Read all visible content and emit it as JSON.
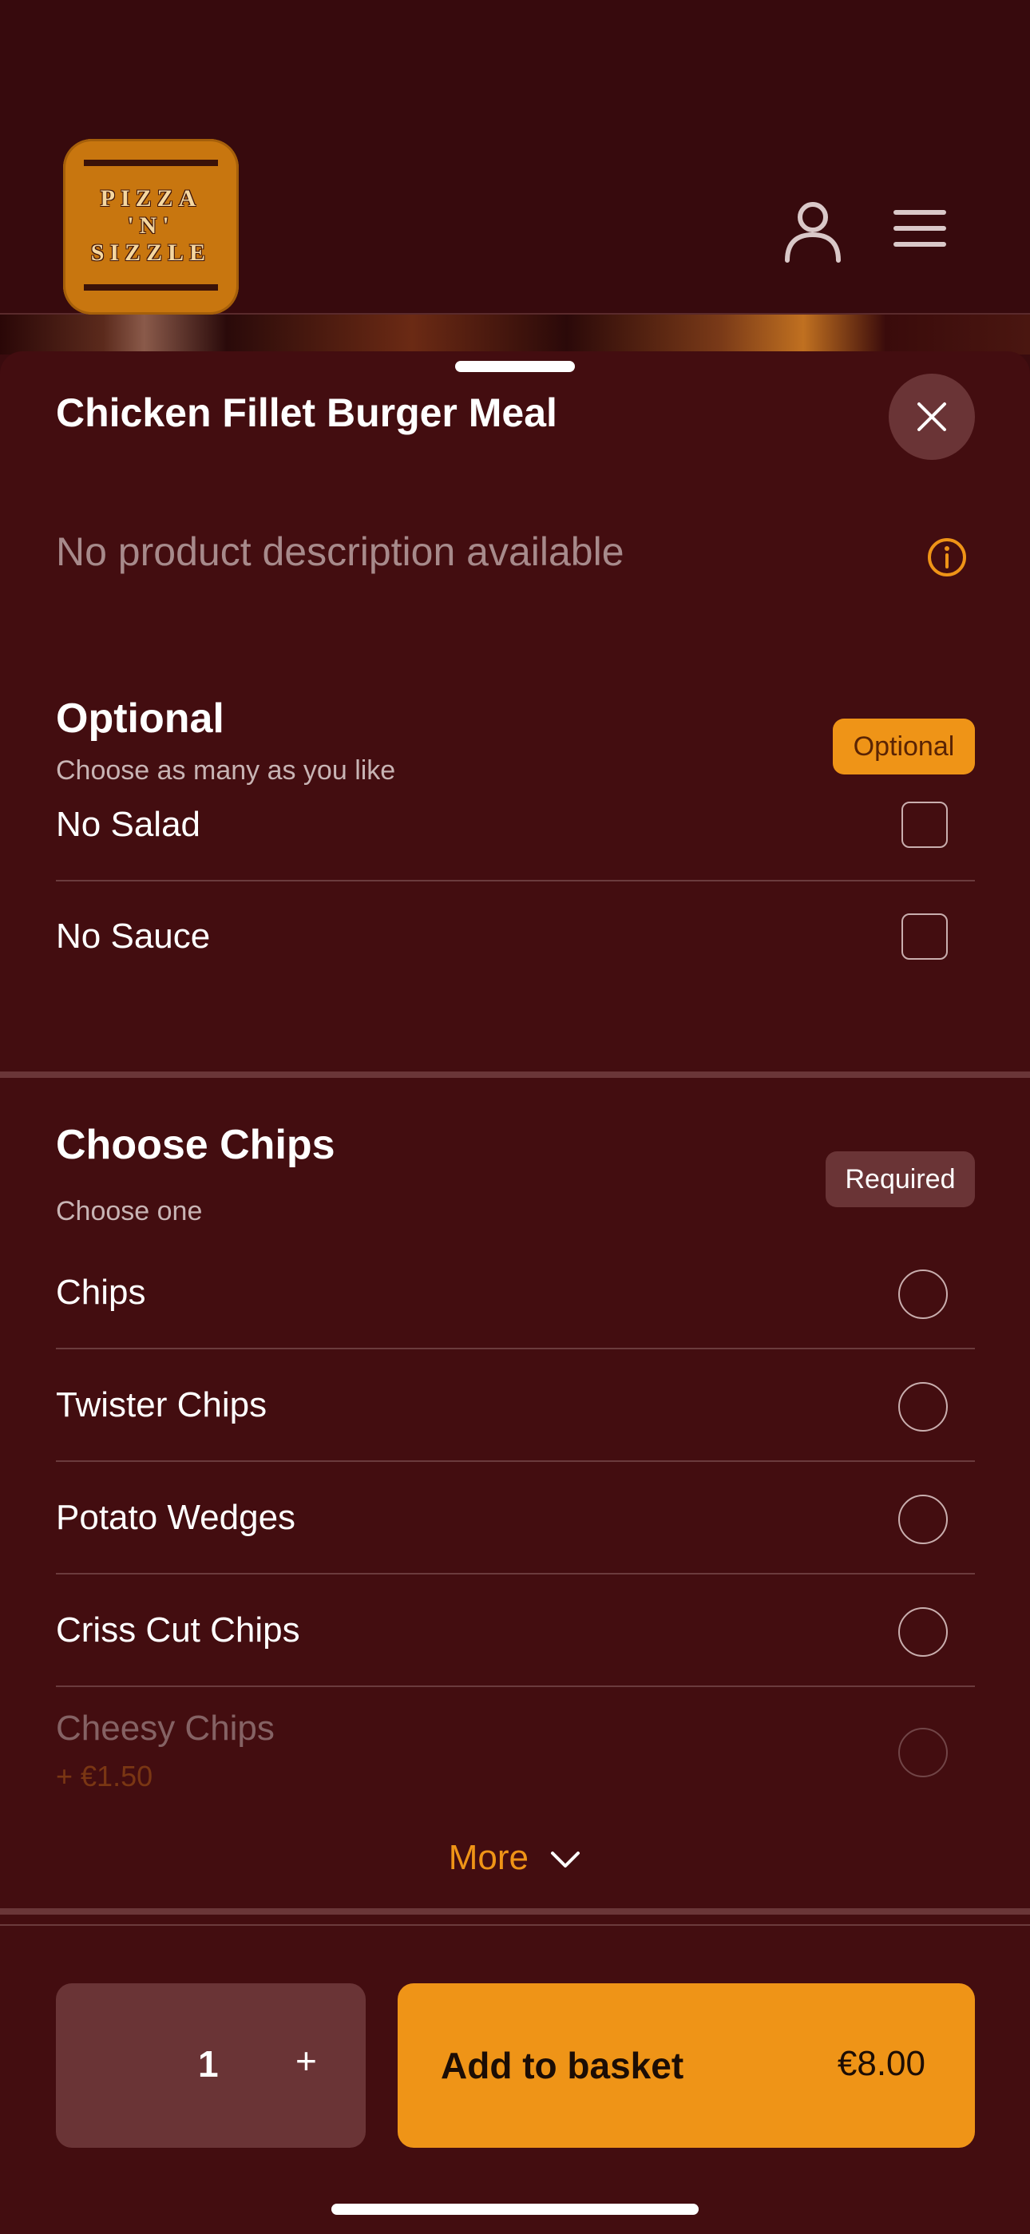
{
  "brand": {
    "logo_text": "PIZZA 'N' SIZZLE"
  },
  "header": {
    "user_icon": "user-icon",
    "menu_icon": "hamburger-menu-icon"
  },
  "product": {
    "title": "Chicken Fillet Burger Meal",
    "description": "No product description available"
  },
  "optional_section": {
    "title": "Optional",
    "subtitle": "Choose as many as you like",
    "badge": "Optional",
    "items": [
      {
        "label": "No Salad",
        "checked": false
      },
      {
        "label": "No Sauce",
        "checked": false
      }
    ]
  },
  "chips_section": {
    "title": "Choose Chips",
    "subtitle": "Choose one",
    "badge": "Required",
    "items": [
      {
        "label": "Chips"
      },
      {
        "label": "Twister Chips"
      },
      {
        "label": "Potato Wedges"
      },
      {
        "label": "Criss Cut Chips"
      },
      {
        "label": "Cheesy Chips",
        "price": "+ €1.50"
      }
    ],
    "more_label": "More"
  },
  "footer": {
    "quantity": "1",
    "plus_label": "+",
    "add_label": "Add to basket",
    "price": "€8.00"
  },
  "colors": {
    "accent": "#ef9417",
    "background": "#430d10",
    "header": "#370a0d"
  }
}
